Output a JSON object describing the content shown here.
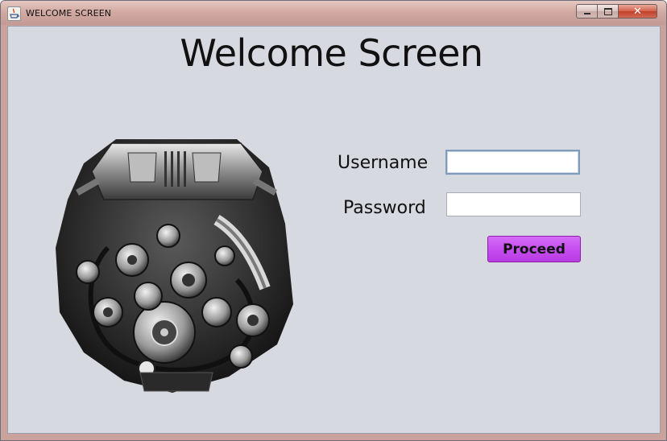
{
  "window": {
    "title": "WELCOME SCREEN",
    "controls": {
      "minimize": "minimize-icon",
      "maximize": "maximize-icon",
      "close": "close-icon"
    }
  },
  "main": {
    "heading": "Welcome Screen",
    "image": "car-engine-image",
    "form": {
      "username_label": "Username",
      "username_value": "",
      "password_label": "Password",
      "password_value": "",
      "submit_label": "Proceed"
    }
  },
  "colors": {
    "content_background": "#d6d9e0",
    "button_accent": "#c44cef",
    "titlebar": "#d2aaa3",
    "close_button": "#c03f29"
  }
}
